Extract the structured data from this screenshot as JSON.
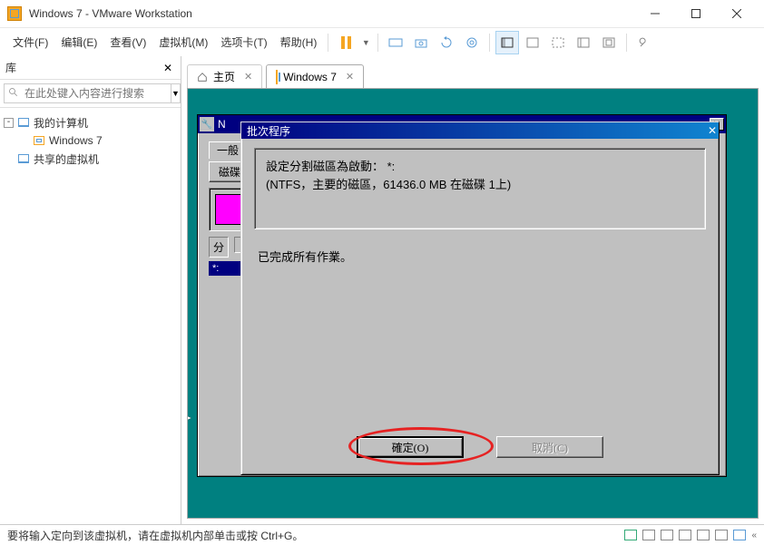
{
  "titlebar": {
    "title": "Windows 7 - VMware Workstation"
  },
  "menu": {
    "file": "文件(F)",
    "edit": "编辑(E)",
    "view": "查看(V)",
    "vm": "虚拟机(M)",
    "tabs": "选项卡(T)",
    "help": "帮助(H)"
  },
  "sidebar": {
    "title": "库",
    "search_placeholder": "在此处键入内容进行搜索",
    "root": "我的计算机",
    "vm": "Windows 7",
    "shared": "共享的虚拟机"
  },
  "tabs": {
    "home": "主页",
    "vm": "Windows 7"
  },
  "inner_window": {
    "title_prefix": "N",
    "tab_general": "一般",
    "btn_disk": "磁碟",
    "section_part": "分",
    "star_label": "*:"
  },
  "modal": {
    "m_title": "批次程序",
    "msg_line1": "設定分割磁區為啟動：  *:",
    "msg_line2": "   (NTFS，主要的磁區，61436.0 MB 在磁碟 1上)",
    "status": "已完成所有作業。",
    "ok": "確定(O)",
    "cancel": "取消(C)"
  },
  "statusbar": {
    "text": "要将输入定向到该虚拟机，请在虚拟机内部单击或按 Ctrl+G。"
  }
}
